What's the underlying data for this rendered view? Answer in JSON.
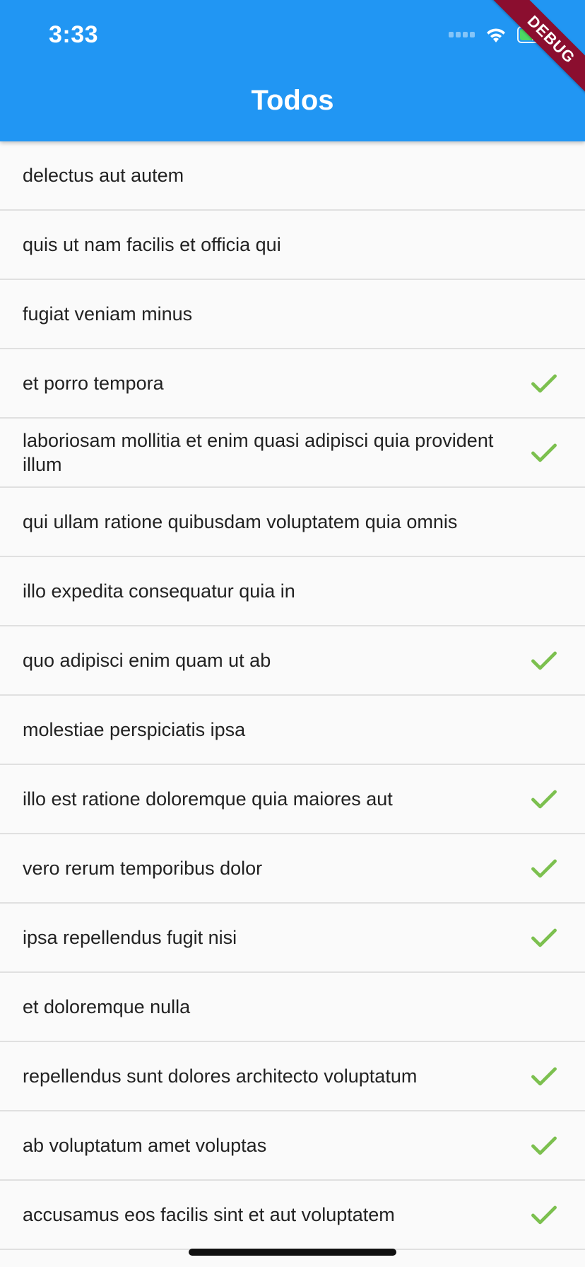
{
  "status_bar": {
    "time": "3:33"
  },
  "app_bar": {
    "title": "Todos"
  },
  "debug_banner": "DEBUG",
  "colors": {
    "primary": "#2196f3",
    "check": "#7cc04f",
    "banner": "#8b0e2f"
  },
  "todos": [
    {
      "title": "delectus aut autem",
      "completed": false
    },
    {
      "title": "quis ut nam facilis et officia qui",
      "completed": false
    },
    {
      "title": "fugiat veniam minus",
      "completed": false
    },
    {
      "title": "et porro tempora",
      "completed": true
    },
    {
      "title": "laboriosam mollitia et enim quasi adipisci quia provident illum",
      "completed": true
    },
    {
      "title": "qui ullam ratione quibusdam voluptatem quia omnis",
      "completed": false
    },
    {
      "title": "illo expedita consequatur quia in",
      "completed": false
    },
    {
      "title": "quo adipisci enim quam ut ab",
      "completed": true
    },
    {
      "title": "molestiae perspiciatis ipsa",
      "completed": false
    },
    {
      "title": "illo est ratione doloremque quia maiores aut",
      "completed": true
    },
    {
      "title": "vero rerum temporibus dolor",
      "completed": true
    },
    {
      "title": "ipsa repellendus fugit nisi",
      "completed": true
    },
    {
      "title": "et doloremque nulla",
      "completed": false
    },
    {
      "title": "repellendus sunt dolores architecto voluptatum",
      "completed": true
    },
    {
      "title": "ab voluptatum amet voluptas",
      "completed": true
    },
    {
      "title": "accusamus eos facilis sint et aut voluptatem",
      "completed": true
    }
  ]
}
